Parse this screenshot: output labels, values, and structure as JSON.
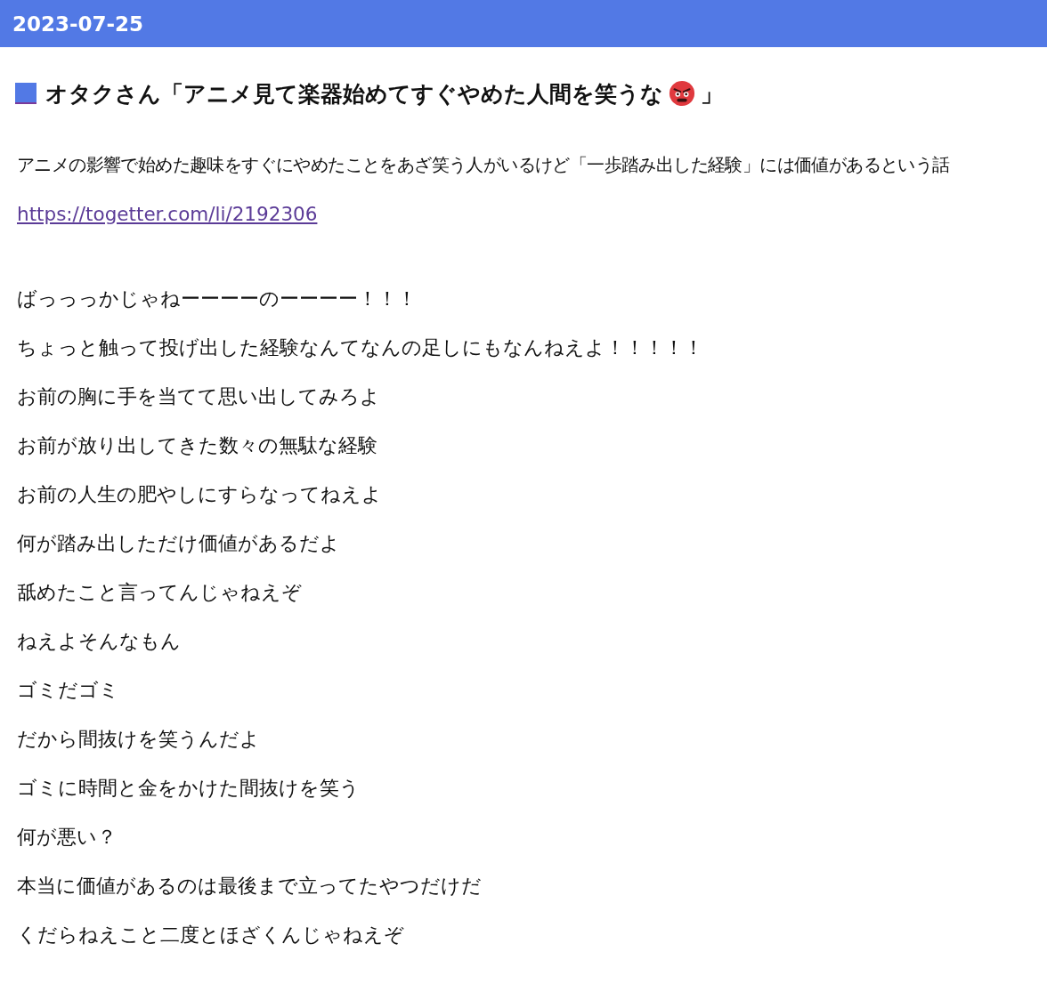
{
  "header": {
    "date": "2023-07-25"
  },
  "title": {
    "text_before": "オタクさん「アニメ見て楽器始めてすぐやめた人間を笑うな",
    "text_after": "」"
  },
  "summary": "アニメの影響で始めた趣味をすぐにやめたことをあざ笑う人がいるけど「一歩踏み出した経験」には価値があるという話",
  "link": {
    "text": "https://togetter.com/li/2192306",
    "visited": true
  },
  "lines": [
    "ばっっっかじゃねーーーーのーーーー！！！",
    "ちょっと触って投げ出した経験なんてなんの足しにもなんねえよ！！！！！",
    "お前の胸に手を当てて思い出してみろよ",
    "お前が放り出してきた数々の無駄な経験",
    "お前の人生の肥やしにすらなってねえよ",
    "何が踏み出しただけ価値があるだよ",
    "舐めたこと言ってんじゃねえぞ",
    "ねえよそんなもん",
    "ゴミだゴミ",
    "だから間抜けを笑うんだよ",
    "ゴミに時間と金をかけた間抜けを笑う",
    "何が悪い？",
    "本当に価値があるのは最後まで立ってたやつだけだ",
    "くだらねえこと二度とほざくんじゃねえぞ"
  ]
}
